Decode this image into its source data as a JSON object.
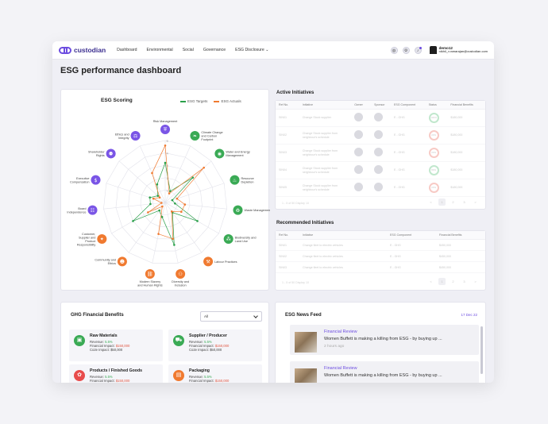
{
  "app": {
    "name": "custodian"
  },
  "nav": [
    "Dashboard",
    "Environmental",
    "Social",
    "Governance",
    "ESG Disclosure"
  ],
  "user": {
    "name": "demo12",
    "email": "nikhil_r.ramarajan@custodian.com"
  },
  "page_title": "ESG performance dashboard",
  "radar": {
    "title": "ESG Scoring",
    "legend": [
      {
        "label": "ESG Targets",
        "color": "#2aa04a"
      },
      {
        "label": "ESG Actuals",
        "color": "#f07a30"
      }
    ],
    "labels": [
      {
        "text": "Risk Management",
        "icon": "shield-icon",
        "color": "#7a55e6"
      },
      {
        "text": "Climate Change and Carbon Footprint",
        "icon": "leaf-icon",
        "color": "#3aaa55"
      },
      {
        "text": "Water and Energy Management",
        "icon": "droplet-icon",
        "color": "#3aaa55"
      },
      {
        "text": "Resource Depletion",
        "icon": "flame-icon",
        "color": "#3aaa55"
      },
      {
        "text": "Waste Management",
        "icon": "recycle-icon",
        "color": "#3aaa55"
      },
      {
        "text": "Biodiversity and Land Use",
        "icon": "tree-icon",
        "color": "#3aaa55"
      },
      {
        "text": "Labour Practices",
        "icon": "worker-icon",
        "color": "#f07a30"
      },
      {
        "text": "Diversity and Inclusion",
        "icon": "people-icon",
        "color": "#f07a30"
      },
      {
        "text": "Modern Slavery and Human Rights",
        "icon": "chain-icon",
        "color": "#f07a30"
      },
      {
        "text": "Community and Ethics",
        "icon": "community-icon",
        "color": "#f07a30"
      },
      {
        "text": "Customer, Supplier and Product Responsibility",
        "icon": "product-icon",
        "color": "#f07a30"
      },
      {
        "text": "Board Independence",
        "icon": "board-icon",
        "color": "#7a55e6"
      },
      {
        "text": "Executive Compensation",
        "icon": "money-icon",
        "color": "#7a55e6"
      },
      {
        "text": "Shareholder Rights",
        "icon": "shareholder-icon",
        "color": "#7a55e6"
      },
      {
        "text": "Ethics and Integrity",
        "icon": "ethics-icon",
        "color": "#7a55e6"
      }
    ],
    "targets": [
      3.2,
      1.0,
      3.0,
      0.6,
      0.8,
      3.0,
      1.0,
      3.5,
      1.2,
      0.8,
      3.0,
      1.2,
      1.3,
      0.8,
      1.6
    ],
    "actuals": [
      4.6,
      0.8,
      4.2,
      1.0,
      1.6,
      1.5,
      0.9,
      3.0,
      2.6,
      0.4,
      1.6,
      0.3,
      1.0,
      0.6,
      2.6
    ],
    "max": 5
  },
  "active": {
    "title": "Active Initiatives",
    "columns": [
      "Ref No.",
      "Initiative",
      "Owner",
      "Sponsor",
      "ESG Component",
      "Status",
      "Financial Benefits"
    ],
    "rows": [
      {
        "ref": "SIN01",
        "name": "Change Stock supplier",
        "comp": "E - GHG",
        "status": "100%",
        "benefit": "$180,000",
        "ok": true
      },
      {
        "ref": "SIN02",
        "name": "Change Stock supplier from neighbour's schedule",
        "comp": "E - GHG",
        "status": "20%",
        "benefit": "$180,000",
        "ok": false
      },
      {
        "ref": "SIN03",
        "name": "Change Stock supplier from neighbour's schedule",
        "comp": "E - GHG",
        "status": "20%",
        "benefit": "$180,000",
        "ok": false
      },
      {
        "ref": "SIN04",
        "name": "Change Stock supplier from neighbour's schedule",
        "comp": "E - GHG",
        "status": "80%",
        "benefit": "$180,000",
        "ok": true
      },
      {
        "ref": "SIN05",
        "name": "Change Stock supplier from neighbour's schedule",
        "comp": "E - GHG",
        "status": "20%",
        "benefit": "$180,000",
        "ok": false
      }
    ],
    "pager_info": "1 - 5 of 50  Display  10",
    "pages": [
      "<",
      "1",
      "2",
      "3",
      ">"
    ]
  },
  "recommended": {
    "title": "Recommended Initiatives",
    "columns": [
      "Ref No.",
      "Initiative",
      "ESG Component",
      "Financial Benefits"
    ],
    "rows": [
      {
        "ref": "SIN01",
        "name": "Change fleet to electric vehicles",
        "comp": "E - GHG",
        "benefit": "$450,000"
      },
      {
        "ref": "SIN02",
        "name": "Change fleet to electric vehicles",
        "comp": "E - GHG",
        "benefit": "$450,000"
      },
      {
        "ref": "SIN03",
        "name": "Change fleet to electric vehicles",
        "comp": "E - GHG",
        "benefit": "$450,000"
      }
    ],
    "pager_info": "1 - 5 of 50  Display  10",
    "pages": [
      "<",
      "1",
      "2",
      "3",
      ">"
    ]
  },
  "ghg": {
    "title": "GHG Financial Benefits",
    "filter": "All",
    "items": [
      {
        "title": "Raw Materials",
        "rev": "Revenue: ",
        "rev_v": "5.5%",
        "fi": "Financial Impact: ",
        "fi_v": "$150,000",
        "co2": "Co2e Impact: $50,000",
        "color": "#3aaa55",
        "icon": "box-icon"
      },
      {
        "title": "Supplier / Producer",
        "rev": "Revenue: ",
        "rev_v": "5.5%",
        "fi": "Financial Impact: ",
        "fi_v": "$150,000",
        "co2": "Co2e Impact: $50,000",
        "color": "#3aaa55",
        "icon": "truck-icon"
      },
      {
        "title": "Products / Finished Goods",
        "rev": "Revenue: ",
        "rev_v": "5.5%",
        "fi": "Financial Impact: ",
        "fi_v": "$150,000",
        "co2": "",
        "color": "#e84c4c",
        "icon": "goods-icon"
      },
      {
        "title": "Packaging",
        "rev": "Revenue: ",
        "rev_v": "5.5%",
        "fi": "Financial Impact: ",
        "fi_v": "$150,000",
        "co2": "",
        "color": "#f07a30",
        "icon": "package-icon"
      }
    ]
  },
  "news": {
    "title": "ESG News Feed",
    "date": "17 Dec 22",
    "items": [
      {
        "source": "Financial Review",
        "text": "Women Buffett is making a killing from ESG - by buying up ...",
        "time": "2 hours ago"
      },
      {
        "source": "Financial Review",
        "text": "Women Buffett is making a killing from ESG - by buying up ...",
        "time": ""
      }
    ]
  }
}
